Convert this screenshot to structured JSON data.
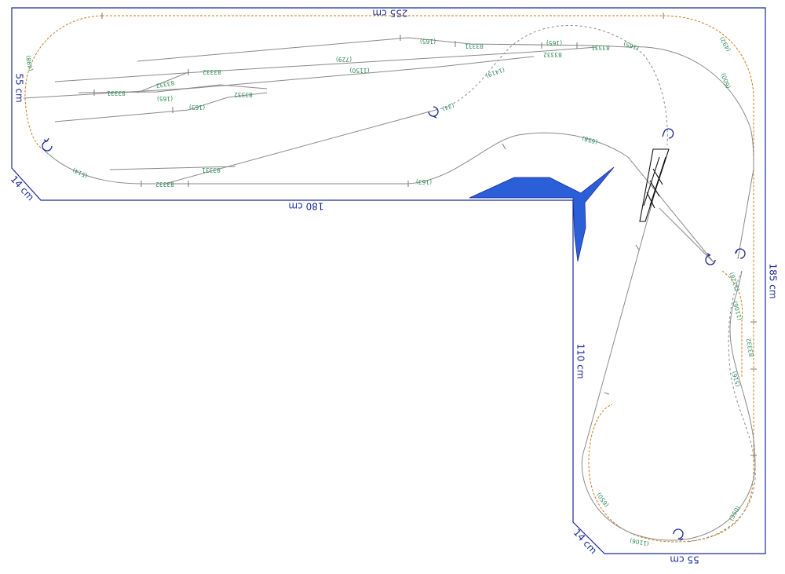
{
  "plan": {
    "dimensions": {
      "top": "255 cm",
      "left": "55 cm",
      "corner_left": "14 cm",
      "middle": "180 cm",
      "right": "185 cm",
      "inner_vertical": "110 cm",
      "corner_bottom": "14 cm",
      "bottom": "55 cm"
    },
    "track_labels": [
      "(165)",
      "83331",
      "(165)",
      "83331",
      "(729)",
      "83332",
      "(1150)",
      "(1419)",
      "(165)",
      "(492)",
      "(600)",
      "83332",
      "83331",
      "83332",
      "(165)",
      "(165)",
      "83332",
      "(34)",
      "(658)",
      "83331",
      "83332",
      "(514)",
      "(163)",
      "(498)",
      "(1128)",
      "(1106)",
      "83332",
      "(516)",
      "(650)",
      "(1106)",
      "(350)"
    ]
  },
  "colors": {
    "benchwork": "#1a2a9a",
    "track": "#8a8a8a",
    "lower_track": "#d07a1a",
    "label": "#2e8b57",
    "water": "#2b5fd8"
  },
  "icons": [
    "reversing-loop-icon",
    "bridge-icon",
    "water-icon"
  ]
}
